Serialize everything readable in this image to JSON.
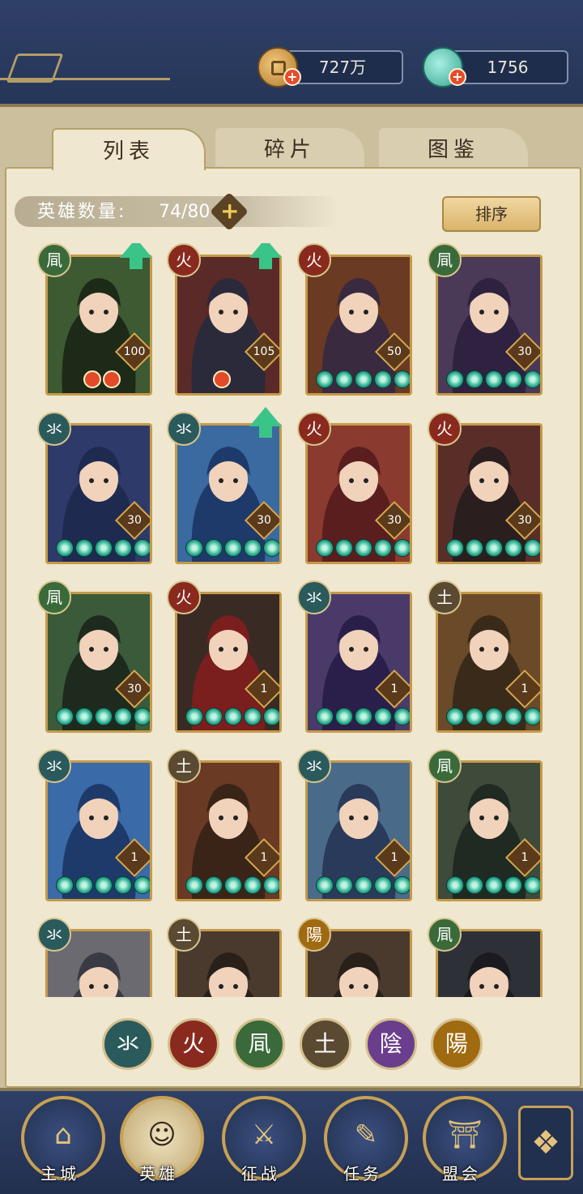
{
  "resources": {
    "coins": "727万",
    "jade": "1756"
  },
  "tabs": [
    "列表",
    "碎片",
    "图鉴"
  ],
  "hero_count": {
    "label": "英雄数量:",
    "value": "74/80"
  },
  "sort_label": "排序",
  "element_glyphs": {
    "water": "氺",
    "fire": "火",
    "wind": "凬",
    "earth": "土",
    "yin": "陰",
    "yang": "陽"
  },
  "element_colors": {
    "water": "#2b5a5c",
    "fire": "#8a2a1e",
    "wind": "#3a6a3a",
    "earth": "#5a4a32",
    "yin": "#6a3e8c",
    "yang": "#a06a10"
  },
  "heroes": [
    {
      "element": "wind",
      "level": "100",
      "stars": 0,
      "tokens": 2,
      "upgrade": true,
      "bg": "#3e5a32",
      "fg": "#1e2a18"
    },
    {
      "element": "fire",
      "level": "105",
      "stars": 0,
      "tokens": 1,
      "upgrade": true,
      "bg": "#5a2a28",
      "fg": "#2a2a3a"
    },
    {
      "element": "fire",
      "level": "50",
      "stars": 5,
      "tokens": 0,
      "upgrade": false,
      "bg": "#6a3a22",
      "fg": "#3a2a40"
    },
    {
      "element": "wind",
      "level": "30",
      "stars": 5,
      "tokens": 0,
      "upgrade": false,
      "bg": "#4a3a58",
      "fg": "#2e2240"
    },
    {
      "element": "water",
      "level": "30",
      "stars": 5,
      "tokens": 0,
      "upgrade": false,
      "bg": "#2e3a6a",
      "fg": "#1e2a50"
    },
    {
      "element": "water",
      "level": "30",
      "stars": 5,
      "tokens": 0,
      "upgrade": true,
      "bg": "#3a6aa0",
      "fg": "#1e3a6a"
    },
    {
      "element": "fire",
      "level": "30",
      "stars": 5,
      "tokens": 0,
      "upgrade": false,
      "bg": "#8a3a2e",
      "fg": "#5a1e1e"
    },
    {
      "element": "fire",
      "level": "30",
      "stars": 5,
      "tokens": 0,
      "upgrade": false,
      "bg": "#5a2e28",
      "fg": "#2a1e1e"
    },
    {
      "element": "wind",
      "level": "30",
      "stars": 5,
      "tokens": 0,
      "upgrade": false,
      "bg": "#3a5a3a",
      "fg": "#1e2a1e"
    },
    {
      "element": "fire",
      "level": "1",
      "stars": 5,
      "tokens": 0,
      "upgrade": false,
      "bg": "#3a2a24",
      "fg": "#7a1e1e"
    },
    {
      "element": "water",
      "level": "1",
      "stars": 5,
      "tokens": 0,
      "upgrade": false,
      "bg": "#4a3a6a",
      "fg": "#2a1e4a"
    },
    {
      "element": "earth",
      "level": "1",
      "stars": 5,
      "tokens": 0,
      "upgrade": false,
      "bg": "#6a4a28",
      "fg": "#3a2a1a"
    },
    {
      "element": "water",
      "level": "1",
      "stars": 5,
      "tokens": 0,
      "upgrade": false,
      "bg": "#3a6aa8",
      "fg": "#1e3a6a"
    },
    {
      "element": "earth",
      "level": "1",
      "stars": 5,
      "tokens": 0,
      "upgrade": false,
      "bg": "#6a3a24",
      "fg": "#3a2418"
    },
    {
      "element": "water",
      "level": "1",
      "stars": 5,
      "tokens": 0,
      "upgrade": false,
      "bg": "#4a6a8a",
      "fg": "#2a3a5a"
    },
    {
      "element": "wind",
      "level": "1",
      "stars": 5,
      "tokens": 0,
      "upgrade": false,
      "bg": "#3e4a3a",
      "fg": "#1e2a22"
    },
    {
      "element": "water",
      "level": "",
      "stars": 0,
      "tokens": 0,
      "upgrade": false,
      "bg": "#6a6a70",
      "fg": "#3a3a44"
    },
    {
      "element": "earth",
      "level": "",
      "stars": 0,
      "tokens": 0,
      "upgrade": false,
      "bg": "#4a3a2e",
      "fg": "#2a201a"
    },
    {
      "element": "yang",
      "level": "",
      "stars": 0,
      "tokens": 0,
      "upgrade": false,
      "bg": "#4a3a2e",
      "fg": "#2a201a"
    },
    {
      "element": "wind",
      "level": "",
      "stars": 0,
      "tokens": 0,
      "upgrade": false,
      "bg": "#2e3038",
      "fg": "#1a1a20"
    }
  ],
  "filters": [
    "water",
    "fire",
    "wind",
    "earth",
    "yin",
    "yang"
  ],
  "nav": [
    {
      "label": "主城",
      "icon": "city-gate-icon",
      "glyph": "⌂"
    },
    {
      "label": "英雄",
      "icon": "hero-icon",
      "glyph": "☺"
    },
    {
      "label": "征战",
      "icon": "battle-icon",
      "glyph": "⚔"
    },
    {
      "label": "任务",
      "icon": "task-icon",
      "glyph": "✎"
    },
    {
      "label": "盟会",
      "icon": "alliance-icon",
      "glyph": "⛩"
    }
  ],
  "more_icon": "menu-icon"
}
